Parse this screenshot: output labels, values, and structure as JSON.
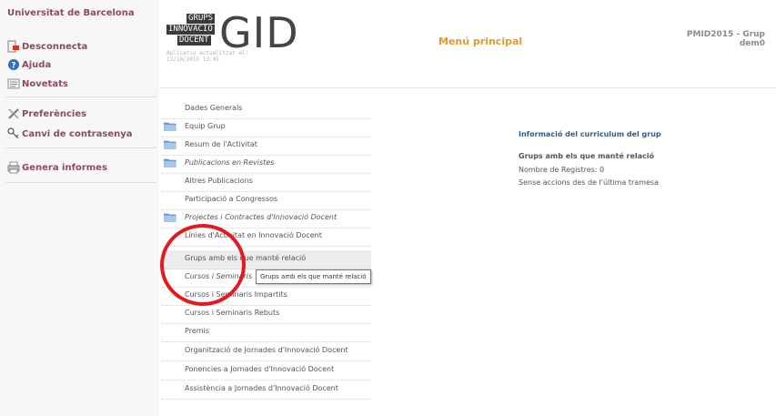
{
  "sidebar": {
    "university": "Universitat de Barcelona",
    "items": [
      {
        "label": "Desconnecta",
        "icon": "logout-icon"
      },
      {
        "label": "Ajuda",
        "icon": "help-icon"
      },
      {
        "label": "Novetats",
        "icon": "news-icon"
      },
      {
        "label": "Preferències",
        "icon": "tools-icon"
      },
      {
        "label": "Canvi de contrasenya",
        "icon": "key-icon"
      },
      {
        "label": "Genera informes",
        "icon": "printer-icon"
      }
    ]
  },
  "header": {
    "logo_line1": "GRUPS",
    "logo_line2": "INNOVACIÓ",
    "logo_line3": "DOCENT",
    "logo_text": "GID",
    "updated_label": "Aplicatiu actualitzat el:",
    "updated_date": "13/10/2015 13:45",
    "menu_title": "Menú principal",
    "group_line1": "PMID2015 - Grup",
    "group_line2": "dem0"
  },
  "menu": {
    "items": [
      {
        "label": "Dades Generals"
      },
      {
        "label": "Equip Grup"
      },
      {
        "label": "Resum de l'Activitat"
      },
      {
        "label": "Publicacions en Revistes"
      },
      {
        "label": "Altres Publicacions"
      },
      {
        "label": "Participació a Congressos"
      },
      {
        "label": "Projectes i Contractes d'Innovació Docent"
      },
      {
        "label": "Línies d'Activitat en Innovació Docent"
      },
      {
        "label": "Grups amb els que manté relació"
      },
      {
        "label": "Cursos i Seminaris"
      },
      {
        "label": "Cursos i Seminaris Impartits"
      },
      {
        "label": "Cursos i Seminaris Rebuts"
      },
      {
        "label": "Premis"
      },
      {
        "label": "Organització de Jornades d'Innovació Docent"
      },
      {
        "label": "Ponencies a Jornades d'Innovació Docent"
      },
      {
        "label": "Assistència a Jornades d'Innovació Docent"
      }
    ]
  },
  "info": {
    "heading": "Informació del curriculum del grup",
    "subheading": "Grups amb els que manté relació",
    "records": "Nombre de Registres: 0",
    "actions": "Sense accions des de l'última tramesa"
  },
  "tooltip": {
    "text": "Grups amb els que manté relació"
  },
  "colors": {
    "sidebar_link": "#8e4a5c",
    "menu_title": "#e19a2c",
    "info_heading": "#2e5d8c",
    "annotation": "#e11b22"
  }
}
